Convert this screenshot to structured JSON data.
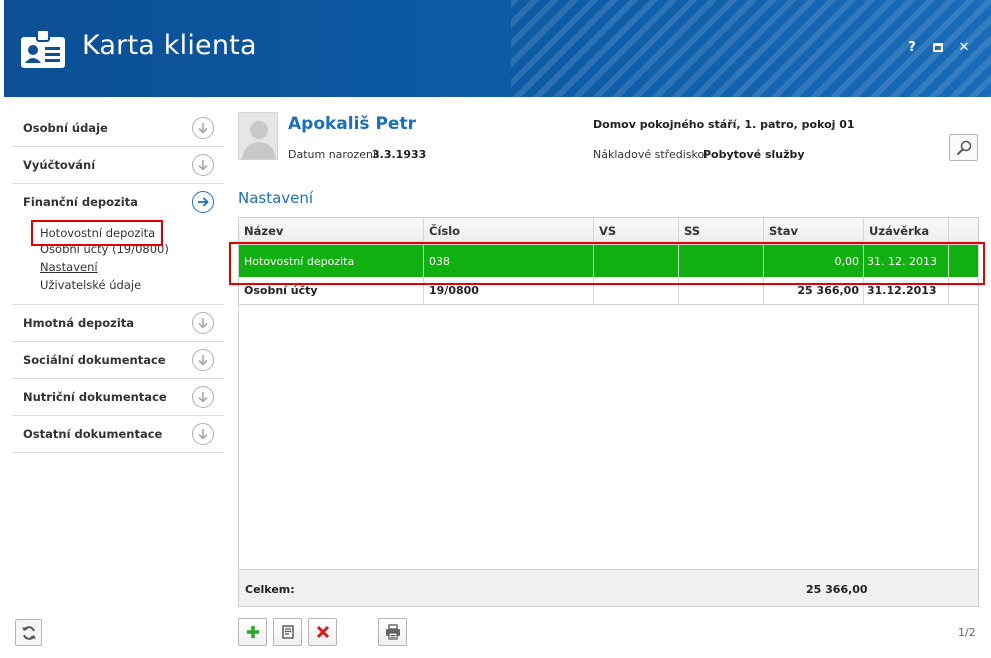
{
  "window": {
    "title": "Karta klienta",
    "help": "?",
    "close": "✕"
  },
  "sidebar": {
    "sections": [
      {
        "label": "Osobní údaje"
      },
      {
        "label": "Vyúčtování"
      },
      {
        "label": "Finanční depozita"
      },
      {
        "label": "Hmotná depozita"
      },
      {
        "label": "Sociální dokumentace"
      },
      {
        "label": "Nutriční dokumentace"
      },
      {
        "label": "Ostatní dokumentace"
      }
    ],
    "fin_items": [
      "Hotovostní depozita",
      "Osobní účty (19/0800)",
      "Nastavení",
      "Uživatelské údaje"
    ]
  },
  "client": {
    "name": "Apokališ Petr",
    "dob_label": "Datum narození:",
    "dob": "3.3.1933",
    "address": "Domov pokojného stáří, 1. patro, pokoj 01",
    "cost_label": "Nákladové středisko:",
    "cost": "Pobytové služby"
  },
  "main": {
    "title": "Nastavení",
    "columns": [
      "Název",
      "Číslo",
      "VS",
      "SS",
      "Stav",
      "Uzávěrka"
    ],
    "rows": [
      {
        "name": "Hotovostní depozita",
        "cislo": "038",
        "vs": "",
        "ss": "",
        "stav": "0,00",
        "uzaverka": "31. 12. 2013"
      },
      {
        "name": "Osobní účty",
        "cislo": "19/0800",
        "vs": "",
        "ss": "",
        "stav": "25 366,00",
        "uzaverka": "31.12.2013"
      }
    ],
    "footer_label": "Celkem:",
    "footer_total": "25 366,00",
    "page": "1/2"
  },
  "colors": {
    "header": "#0c4f94",
    "accent": "#1d6fb8",
    "selected_row": "#10b010",
    "highlight": "#e00000"
  }
}
